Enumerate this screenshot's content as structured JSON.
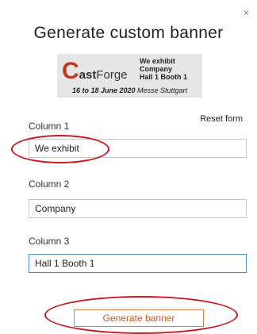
{
  "dialog": {
    "close_glyph": "×",
    "title": "Generate custom banner",
    "reset_label": "Reset form",
    "generate_label": "Generate banner"
  },
  "preview": {
    "logo_c": "C",
    "logo_cast": "ast",
    "logo_forge": "Forge",
    "line1": "We exhibit",
    "line2": "Company",
    "line3": "Hall 1 Booth 1",
    "date": "16 to 18 June 2020",
    "venue": "Messe Stuttgart"
  },
  "fields": [
    {
      "label": "Column 1",
      "value": "We exhibit"
    },
    {
      "label": "Column 2",
      "value": "Company"
    },
    {
      "label": "Column 3",
      "value": "Hall 1 Booth 1"
    }
  ],
  "colors": {
    "accent": "#d05a22",
    "annotation": "#d0141b",
    "focus": "#4f90c8",
    "logo_red": "#c0391f"
  }
}
